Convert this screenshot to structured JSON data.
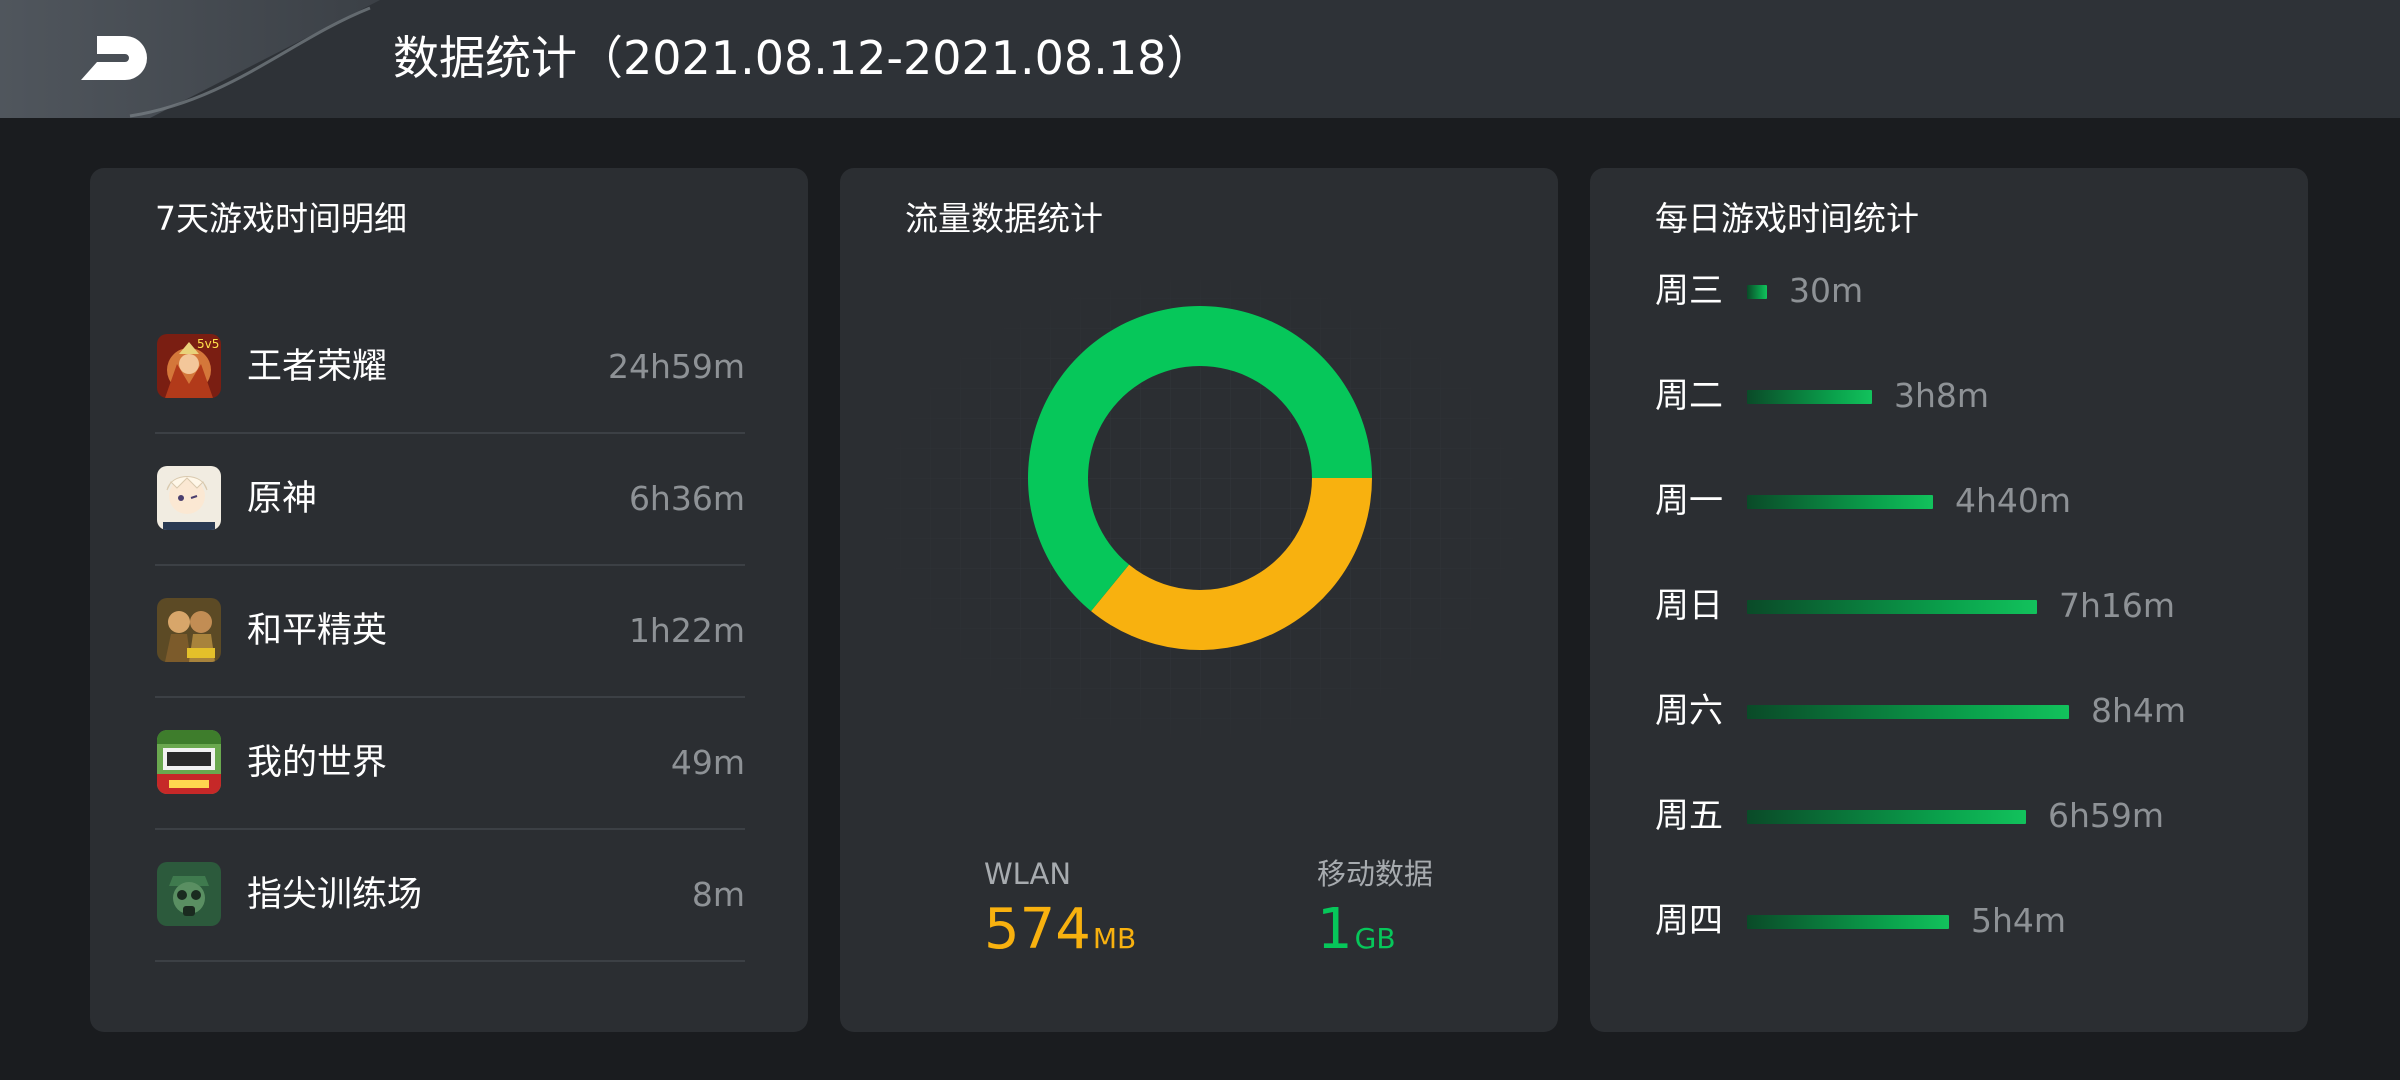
{
  "header": {
    "title": "数据统计（2021.08.12-2021.08.18）"
  },
  "games_card": {
    "title": "7天游戏时间明细",
    "items": [
      {
        "name": "王者荣耀",
        "time": "24h59m",
        "icon": "honor-of-kings-icon",
        "color": "#b8401f"
      },
      {
        "name": "原神",
        "time": "6h36m",
        "icon": "genshin-impact-icon",
        "color": "#f3ede2"
      },
      {
        "name": "和平精英",
        "time": "1h22m",
        "icon": "peacekeeper-elite-icon",
        "color": "#8a6a2c"
      },
      {
        "name": "我的世界",
        "time": "49m",
        "icon": "minecraft-icon",
        "color": "#4f9a3a"
      },
      {
        "name": "指尖训练场",
        "time": "8m",
        "icon": "fingertip-training-icon",
        "color": "#2f6d44"
      }
    ]
  },
  "traffic_card": {
    "title": "流量数据统计",
    "wlan": {
      "label": "WLAN",
      "value": "574",
      "unit": "MB",
      "color": "#f8b10f"
    },
    "mobile": {
      "label": "移动数据",
      "value": "1",
      "unit": "GB",
      "color": "#06c75a"
    },
    "chart_data": {
      "type": "pie",
      "slices": [
        {
          "label": "移动数据",
          "value": 1024,
          "color": "#06c75a"
        },
        {
          "label": "WLAN",
          "value": 574,
          "color": "#f8b10f"
        }
      ]
    }
  },
  "daily_card": {
    "title": "每日游戏时间统计",
    "chart_data": {
      "type": "bar",
      "orientation": "horizontal",
      "categories": [
        "周三",
        "周二",
        "周一",
        "周日",
        "周六",
        "周五",
        "周四"
      ],
      "labels": [
        "30m",
        "3h8m",
        "4h40m",
        "7h16m",
        "8h4m",
        "6h59m",
        "5h4m"
      ],
      "values": [
        30,
        188,
        280,
        436,
        484,
        419,
        304
      ],
      "max": 484
    }
  }
}
